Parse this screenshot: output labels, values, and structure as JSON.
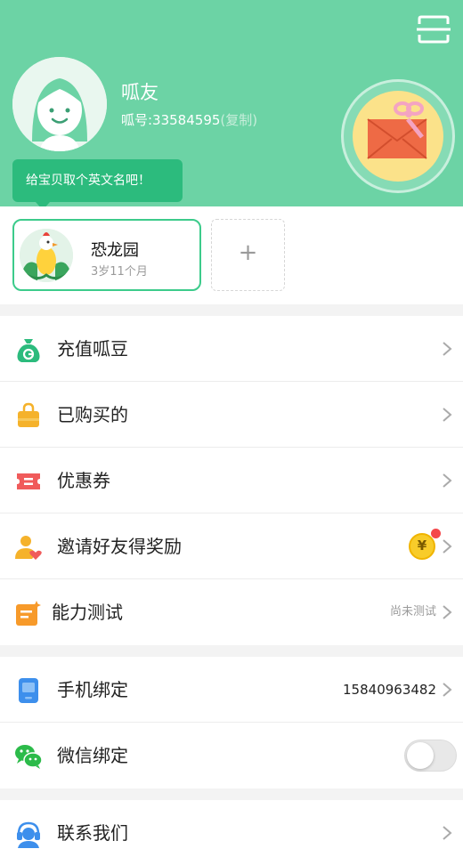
{
  "profile": {
    "name": "呱友",
    "id_label": "呱号:33584595",
    "copy_label": "(复制)",
    "tip": "给宝贝取个英文名吧！"
  },
  "child": {
    "name": "恐龙园",
    "age": "3岁11个月",
    "add_label": "+"
  },
  "menu_group_1": [
    {
      "label": "充值呱豆",
      "icon": "money-bag-icon"
    },
    {
      "label": "已购买的",
      "icon": "shopping-bag-icon"
    },
    {
      "label": "优惠券",
      "icon": "coupon-icon"
    },
    {
      "label": "邀请好友得奖励",
      "icon": "invite-friend-icon",
      "badge": "¥"
    },
    {
      "label": "能力测试",
      "icon": "test-icon",
      "value": "尚未测试"
    }
  ],
  "menu_group_2": [
    {
      "label": "手机绑定",
      "icon": "phone-icon",
      "value": "15840963482"
    },
    {
      "label": "微信绑定",
      "icon": "wechat-icon",
      "toggle": false
    }
  ],
  "menu_group_3": [
    {
      "label": "联系我们",
      "icon": "customer-service-icon"
    }
  ],
  "colors": {
    "header_green": "#6cd3a5",
    "tip_green": "#2cbb7d",
    "card_border": "#3ccb8b",
    "notify_red": "#f4474a"
  }
}
